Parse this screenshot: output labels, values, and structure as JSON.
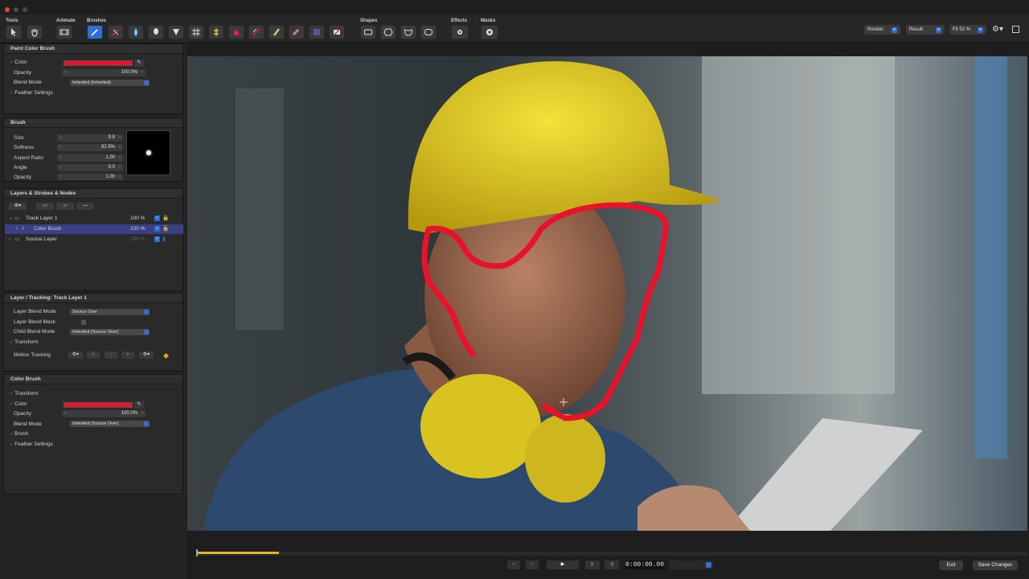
{
  "toolbar": {
    "tools_label": "Tools",
    "animate_label": "Animate",
    "brushes_label": "Brushes",
    "shapes_label": "Shapes",
    "effects_label": "Effects",
    "masks_label": "Masks",
    "render_label": "Render",
    "result_label": "Result",
    "fit_label": "Fit 52 %"
  },
  "paint_color_brush": {
    "title": "Paint Color Brush",
    "color_label": "Color",
    "color_value": "#e8122a",
    "opacity_label": "Opacity",
    "opacity_value": "100.0%",
    "blend_mode_label": "Blend Mode",
    "blend_mode_value": "Inherited (Inherited)",
    "feather_label": "Feather Settings"
  },
  "brush": {
    "title": "Brush",
    "size_label": "Size",
    "size_value": "9.8",
    "softness_label": "Softness",
    "softness_value": "92.9%",
    "aspect_label": "Aspect Ratio",
    "aspect_value": "1.00",
    "angle_label": "Angle",
    "angle_value": "0.0",
    "opacity_label": "Opacity",
    "opacity_value": "1.00"
  },
  "layers": {
    "title": "Layers & Strokes & Nodes",
    "items": [
      {
        "name": "Track Layer 1",
        "opacity": "100 %"
      },
      {
        "name": "Color Brush",
        "opacity": "100 %"
      },
      {
        "name": "Source Layer",
        "opacity": "100 %"
      }
    ]
  },
  "tracking": {
    "title": "Layer / Tracking: Track Layer 1",
    "layer_blend_label": "Layer Blend Mode",
    "layer_blend_value": "Source Over",
    "layer_blend_mask_label": "Layer Blend Mask",
    "child_blend_label": "Child Blend Mode",
    "child_blend_value": "Inherited (Source Over)",
    "transform_label": "Transform",
    "motion_label": "Motion Tracking"
  },
  "color_brush": {
    "title": "Color Brush",
    "transform_label": "Transform",
    "color_label": "Color",
    "color_value": "#e8122a",
    "opacity_label": "Opacity",
    "opacity_value": "100.0%",
    "blend_mode_label": "Blend Mode",
    "blend_mode_value": "Inherited (Source Over)",
    "brush_label": "Brush",
    "feather_label": "Feather Settings"
  },
  "playback": {
    "timecode": "0:00:00.00",
    "progress": 0.1,
    "exit_label": "Exit",
    "save_label": "Save Changes"
  },
  "colors": {
    "accent": "#2c6fd6",
    "stroke": "#e8122a",
    "timeline": "#e0b52c"
  }
}
